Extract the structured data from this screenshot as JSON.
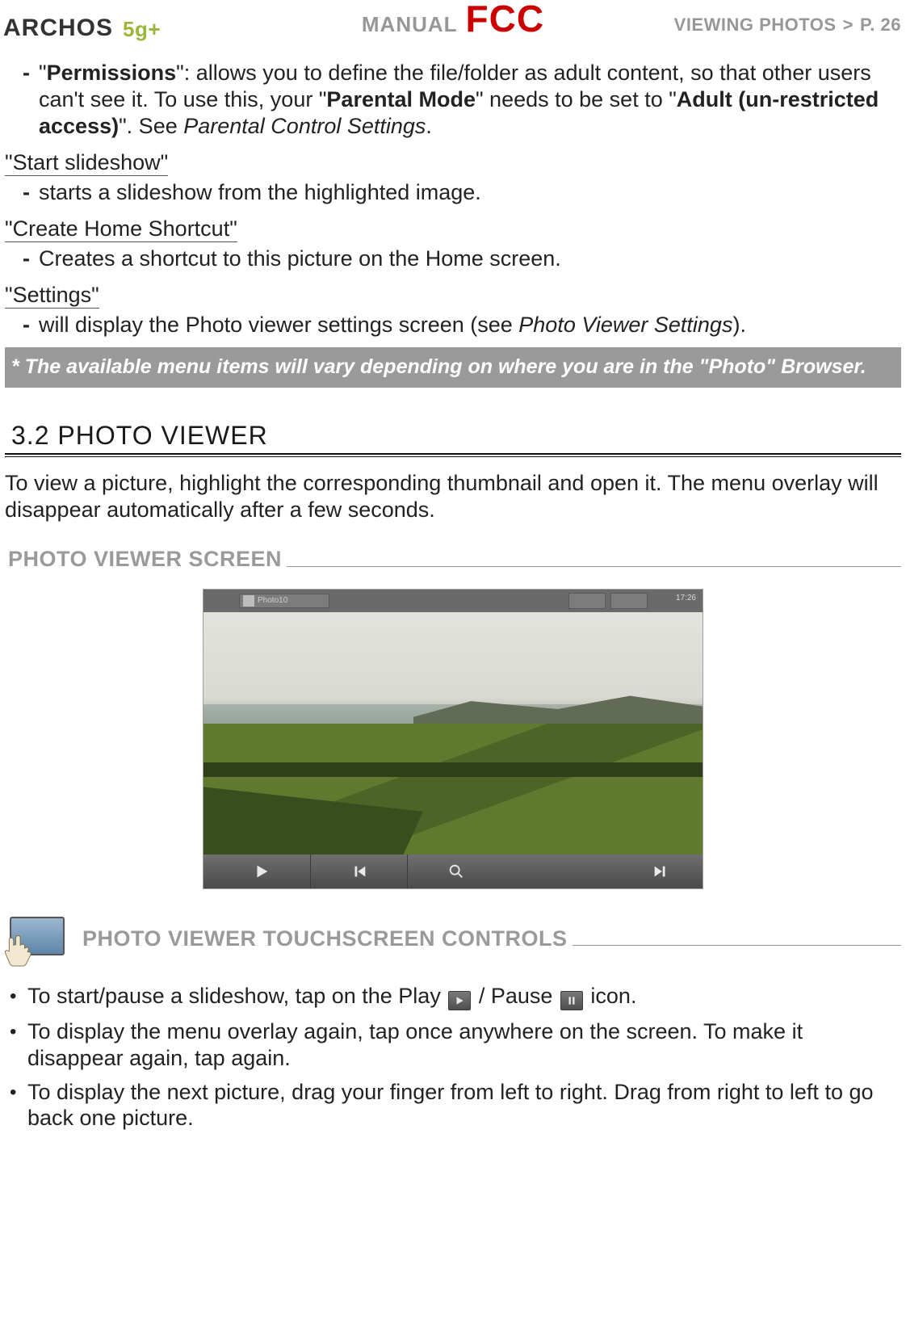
{
  "header": {
    "brand": "ARCHOS",
    "series": "5g+",
    "manual_label": "MANUAL",
    "fcc": "FCC",
    "section_name": "VIEWING PHOTOS",
    "gt": ">",
    "page_label": "P. 26"
  },
  "permissions": {
    "term": "Permissions",
    "body1": "\": allows you to define the file/folder as adult content, so that other users can't see it. To use this, your \"",
    "parental_bold": "Parental Mode",
    "body2": "\" needs to be set to \"",
    "adult_bold": "Adult (un-restricted access)",
    "body3": "\". See ",
    "see_ital": "Parental Control Settings",
    "tail": "."
  },
  "defs": {
    "slideshow_head": "\"Start slideshow\"",
    "slideshow_body": "starts a slideshow from the highlighted image.",
    "shortcut_head": "\"Create Home Shortcut\"",
    "shortcut_body": "Creates a shortcut to this picture on the Home screen.",
    "settings_head": "\"Settings\"",
    "settings_body_pre": "will display the Photo viewer settings screen (see ",
    "settings_body_ital": "Photo Viewer Settings",
    "settings_body_post": ")."
  },
  "notebox": "* The available menu items will vary depending on where you are in the \"Photo\" Browser.",
  "h2": "3.2 PHOTO VIEWER",
  "viewer_para": "To view a picture, highlight the corresponding thumbnail and open it. The menu overlay will disappear automatically after a few seconds.",
  "subhead_screen": "PHOTO VIEWER SCREEN",
  "screenshot": {
    "breadcrumb": "Photo10",
    "time": "17:26"
  },
  "subhead_touch": "PHOTO VIEWER TOUCHSCREEN CONTROLS",
  "bullets": {
    "b1a": "To start/pause a slideshow, tap on the Play ",
    "b1b": " / Pause ",
    "b1c": " icon.",
    "b2": "To display the menu overlay again, tap once anywhere on the screen. To make it disappear again, tap again.",
    "b3": "To display the next picture, drag your finger from left to right. Drag from right to left to go back one picture."
  }
}
